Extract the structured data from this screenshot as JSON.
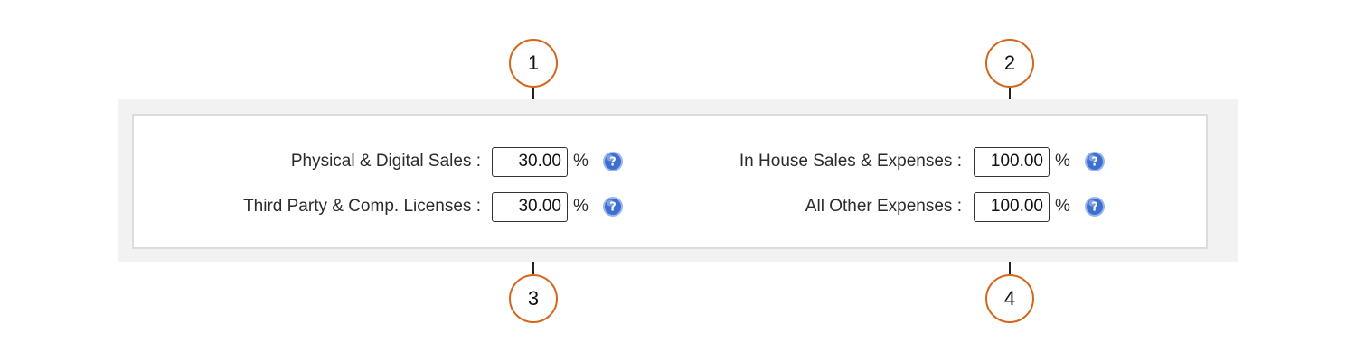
{
  "colors": {
    "callout_border": "#d4661c",
    "panel_background": "#f2f2f2",
    "panel_border": "#dcdcdc",
    "help_icon": "#3d6fd1"
  },
  "form": {
    "left": [
      {
        "label": "Physical & Digital Sales :",
        "value": "30.00",
        "unit": "%",
        "icon": "help-icon"
      },
      {
        "label": "Third Party & Comp. Licenses :",
        "value": "30.00",
        "unit": "%",
        "icon": "help-icon"
      }
    ],
    "right": [
      {
        "label": "In House Sales & Expenses :",
        "value": "100.00",
        "unit": "%",
        "icon": "help-icon"
      },
      {
        "label": "All Other Expenses :",
        "value": "100.00",
        "unit": "%",
        "icon": "help-icon"
      }
    ]
  },
  "callouts": [
    "1",
    "2",
    "3",
    "4"
  ]
}
